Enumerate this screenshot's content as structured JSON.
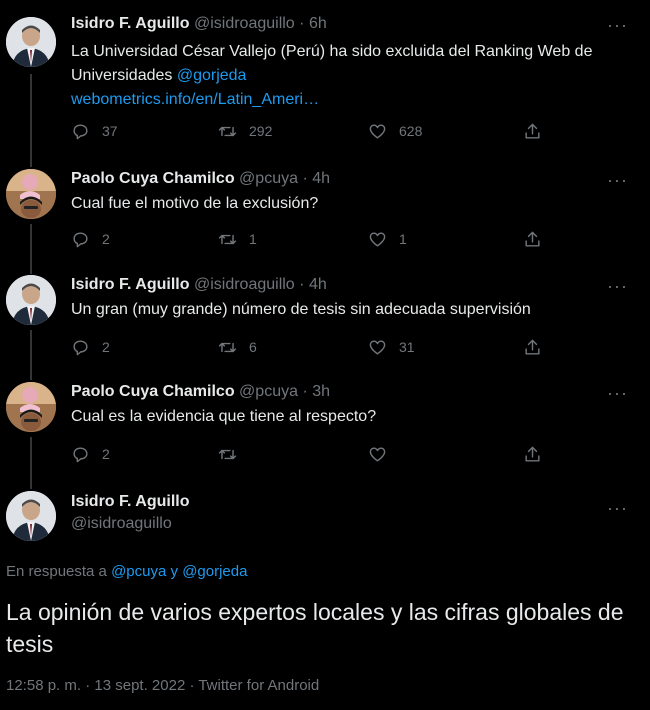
{
  "tweets": [
    {
      "name": "Isidro F. Aguillo",
      "handle": "@isidroaguillo",
      "time": "6h",
      "text": "La Universidad César Vallejo (Perú) ha sido excluida del Ranking Web de",
      "text2": "Universidades ",
      "mention": "@gorjeda",
      "link": "webometrics.info/en/Latin_Ameri…",
      "replies": "37",
      "retweets": "292",
      "likes": "628"
    },
    {
      "name": "Paolo Cuya Chamilco",
      "handle": "@pcuya",
      "time": "4h",
      "text": "Cual fue el motivo de la exclusión?",
      "replies": "2",
      "retweets": "1",
      "likes": "1"
    },
    {
      "name": "Isidro F. Aguillo",
      "handle": "@isidroaguillo",
      "time": "4h",
      "text": "Un gran (muy grande) número de tesis sin adecuada supervisión",
      "replies": "2",
      "retweets": "6",
      "likes": "31"
    },
    {
      "name": "Paolo Cuya Chamilco",
      "handle": "@pcuya",
      "time": "3h",
      "text": "Cual es la evidencia que tiene al respecto?",
      "replies": "2",
      "retweets": "",
      "likes": ""
    }
  ],
  "main": {
    "name": "Isidro F. Aguillo",
    "handle": "@isidroaguillo",
    "reply_prefix": "En respuesta a ",
    "reply_mention1": "@pcuya",
    "reply_and": " y ",
    "reply_mention2": "@gorjeda",
    "text": "La opinión de varios expertos locales y las cifras globales de tesis",
    "meta": "12:58 p. m. · 13 sept. 2022 · Twitter for Android"
  },
  "ui": {
    "dot": "·",
    "more": "···"
  }
}
